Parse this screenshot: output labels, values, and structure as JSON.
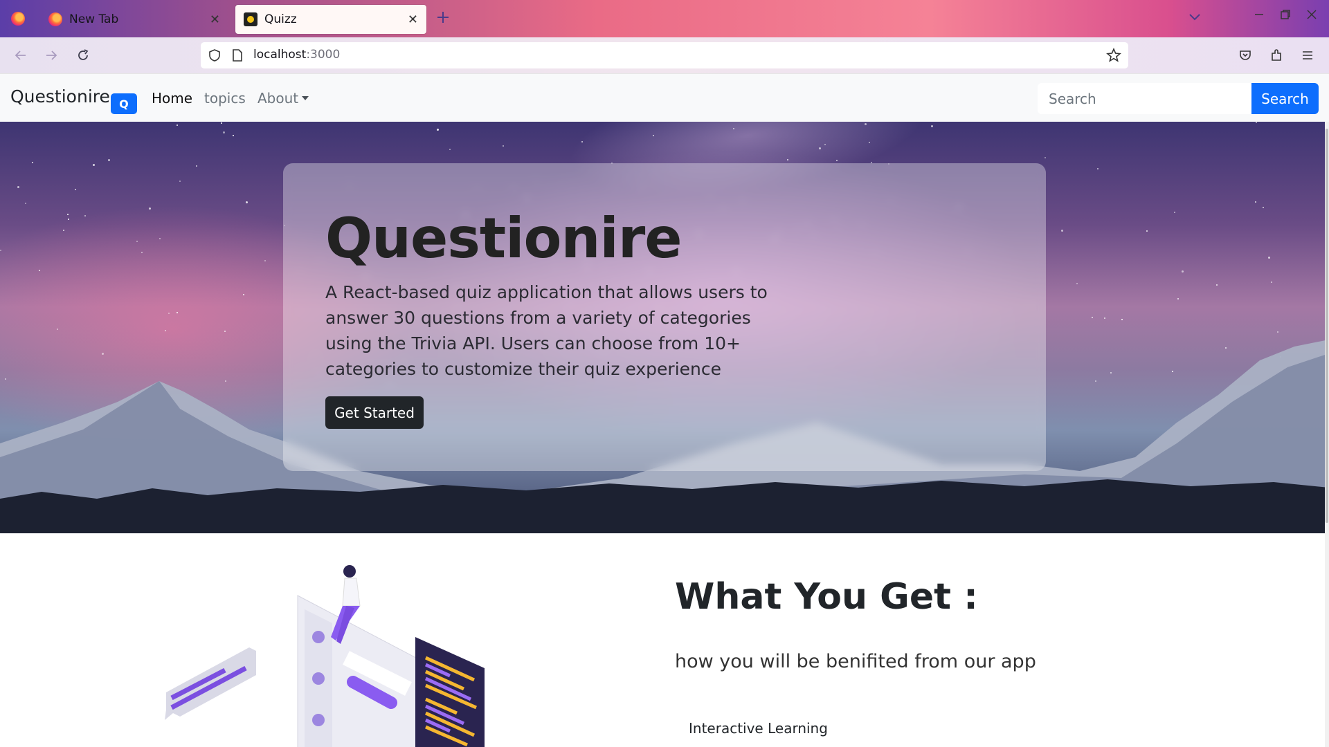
{
  "browser": {
    "tabs": [
      {
        "title": "New Tab",
        "active": false,
        "icon": "firefox-icon"
      },
      {
        "title": "Quizz",
        "active": true,
        "icon": "quiz-favicon"
      }
    ],
    "address": {
      "host": "localhost",
      "port": ":3000"
    }
  },
  "app": {
    "brand": {
      "name": "Questionire",
      "badge": "Q"
    },
    "nav": {
      "home": "Home",
      "topics": "topics",
      "about": "About"
    },
    "search": {
      "placeholder": "Search",
      "button": "Search"
    }
  },
  "hero": {
    "title": "Questionire",
    "description": "A React-based quiz application that allows users to answer 30 questions from a variety of categories using the Trivia API. Users can choose from 10+ categories to customize their quiz experience",
    "cta": "Get Started"
  },
  "features": {
    "title": "What You Get :",
    "subtitle": "how you will be benifited from our app",
    "items": [
      "Interactive Learning"
    ]
  },
  "colors": {
    "primary": "#0d6efd",
    "dark": "#212529",
    "navbar_bg": "#f8f9fa"
  }
}
